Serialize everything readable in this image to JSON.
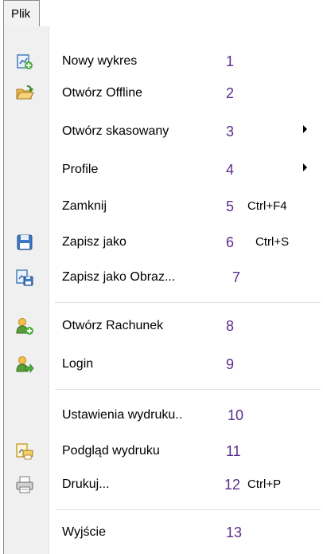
{
  "menubar": {
    "tab_label": "Plik"
  },
  "menu": {
    "items": [
      {
        "label": "Nowy wykres",
        "number": "1",
        "shortcut": "",
        "icon": "new-chart-icon",
        "submenu": false
      },
      {
        "label": "Otwórz Offline",
        "number": "2",
        "shortcut": "",
        "icon": "open-folder-icon",
        "submenu": false
      },
      {
        "label": "Otwórz skasowany",
        "number": "3",
        "shortcut": "",
        "icon": "",
        "submenu": true
      },
      {
        "label": "Profile",
        "number": "4",
        "shortcut": "",
        "icon": "",
        "submenu": true
      },
      {
        "label": "Zamknij",
        "number": "5",
        "shortcut": "Ctrl+F4",
        "icon": "",
        "submenu": false
      },
      {
        "label": "Zapisz jako",
        "number": "6",
        "shortcut": "Ctrl+S",
        "icon": "floppy-disk-icon",
        "submenu": false
      },
      {
        "label": "Zapisz jako Obraz...",
        "number": "7",
        "shortcut": "",
        "icon": "save-image-icon",
        "submenu": false
      },
      {
        "label": "Otwórz Rachunek",
        "number": "8",
        "shortcut": "",
        "icon": "add-account-icon",
        "submenu": false
      },
      {
        "label": "Login",
        "number": "9",
        "shortcut": "",
        "icon": "login-user-icon",
        "submenu": false
      },
      {
        "label": "Ustawienia wydruku..",
        "number": "10",
        "shortcut": "",
        "icon": "",
        "submenu": false
      },
      {
        "label": "Podgląd wydruku",
        "number": "11",
        "shortcut": "",
        "icon": "print-preview-icon",
        "submenu": false
      },
      {
        "label": "Drukuj...",
        "number": "12",
        "shortcut": "Ctrl+P",
        "icon": "printer-icon",
        "submenu": false
      },
      {
        "label": "Wyjście",
        "number": "13",
        "shortcut": "",
        "icon": "",
        "submenu": false
      }
    ]
  },
  "colors": {
    "number_color": "#5b2c8c",
    "gutter": "#f0f0f0",
    "border": "#8a8a8a"
  }
}
